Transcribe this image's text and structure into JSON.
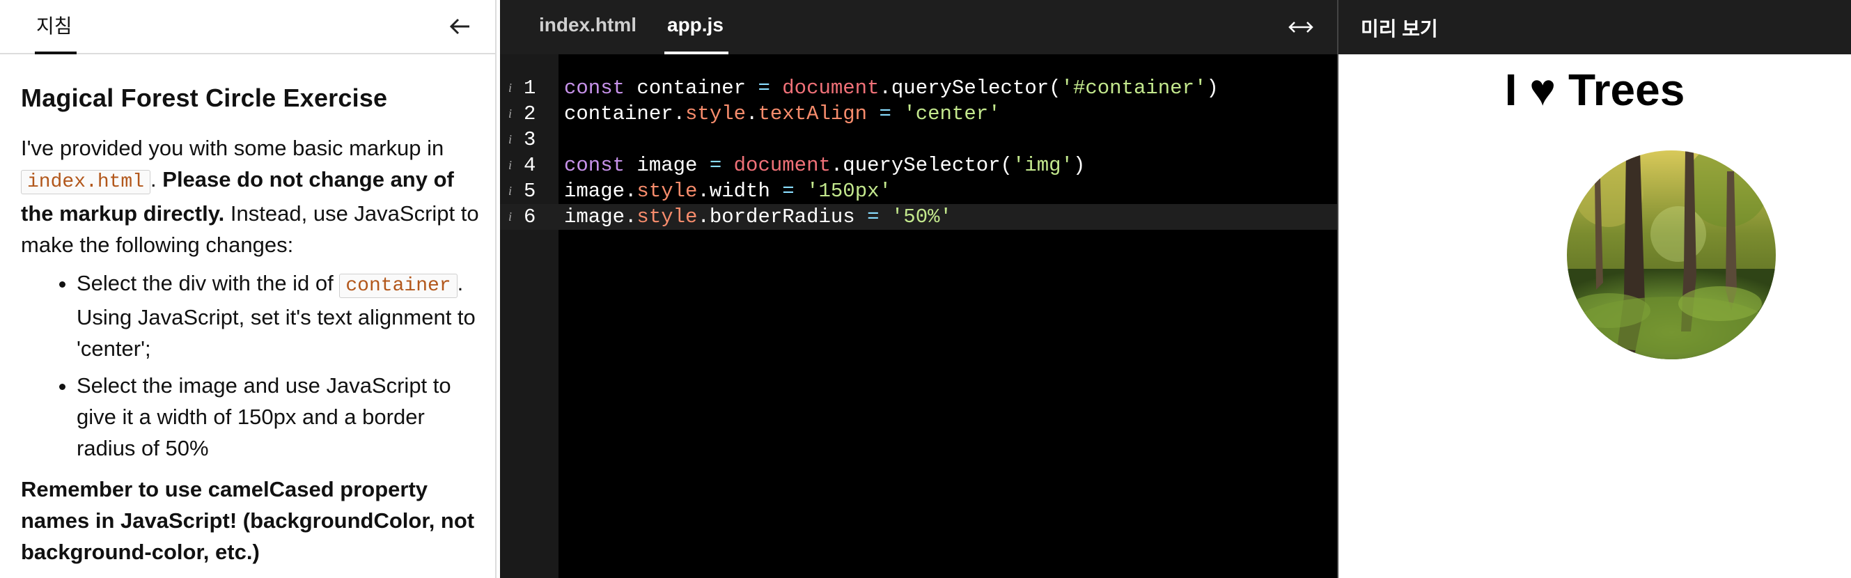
{
  "instructions": {
    "tab_label": "지침",
    "title": "Magical Forest Circle Exercise",
    "intro_before": "I've provided you with some basic markup in ",
    "intro_code": "index.html",
    "intro_bold": "Please do not change any of the markup directly.",
    "intro_after": " Instead, use JavaScript to make the following changes:",
    "items": [
      {
        "before": "Select the div with the id of ",
        "code": "container",
        "after": ". Using JavaScript, set it's text alignment to 'center';"
      },
      {
        "text": "Select the image and use JavaScript to give it a width of 150px and a border radius of 50%"
      }
    ],
    "remember": "Remember to use camelCased property names in JavaScript! (backgroundColor, not background-color, etc.)"
  },
  "editor": {
    "tabs": [
      "index.html",
      "app.js"
    ],
    "active_tab": "app.js",
    "lines": [
      {
        "num": "1",
        "tokens": [
          [
            "kw",
            "const"
          ],
          [
            "plain",
            " container "
          ],
          [
            "op",
            "="
          ],
          [
            "plain",
            " "
          ],
          [
            "doc",
            "document"
          ],
          [
            "plain",
            ".querySelector("
          ],
          [
            "str",
            "'#container'"
          ],
          [
            "plain",
            ")"
          ]
        ]
      },
      {
        "num": "2",
        "tokens": [
          [
            "plain",
            "container."
          ],
          [
            "prop",
            "style"
          ],
          [
            "plain",
            "."
          ],
          [
            "prop",
            "textAlign"
          ],
          [
            "plain",
            " "
          ],
          [
            "op",
            "="
          ],
          [
            "plain",
            " "
          ],
          [
            "str",
            "'center'"
          ]
        ]
      },
      {
        "num": "3",
        "tokens": []
      },
      {
        "num": "4",
        "tokens": [
          [
            "kw",
            "const"
          ],
          [
            "plain",
            " image "
          ],
          [
            "op",
            "="
          ],
          [
            "plain",
            " "
          ],
          [
            "doc",
            "document"
          ],
          [
            "plain",
            ".querySelector("
          ],
          [
            "str",
            "'img'"
          ],
          [
            "plain",
            ")"
          ]
        ]
      },
      {
        "num": "5",
        "tokens": [
          [
            "plain",
            "image."
          ],
          [
            "prop",
            "style"
          ],
          [
            "plain",
            ".width "
          ],
          [
            "op",
            "="
          ],
          [
            "plain",
            " "
          ],
          [
            "str",
            "'150px'"
          ]
        ]
      },
      {
        "num": "6",
        "tokens": [
          [
            "plain",
            "image."
          ],
          [
            "prop",
            "style"
          ],
          [
            "plain",
            ".borderRadius "
          ],
          [
            "op",
            "="
          ],
          [
            "plain",
            " "
          ],
          [
            "str",
            "'50%'"
          ]
        ]
      }
    ],
    "active_line": "6"
  },
  "preview": {
    "label": "미리 보기",
    "heading": "I ♥ Trees"
  },
  "colors": {
    "keyword": "#c792ea",
    "string": "#c3e88d",
    "property": "#f78c6c",
    "inline_code": "#b2571b"
  },
  "icons": [
    "back-arrow-icon",
    "swap-arrows-icon",
    "info-icon"
  ]
}
